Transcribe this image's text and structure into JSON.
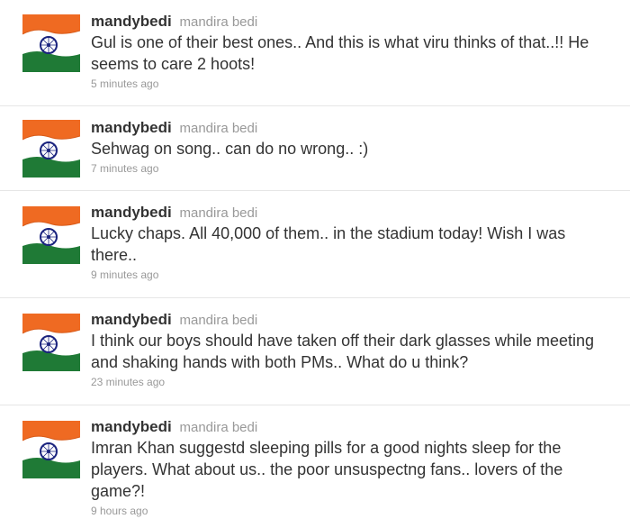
{
  "tweets": [
    {
      "screen_name": "mandybedi",
      "full_name": "mandira bedi",
      "text": "Gul is one of their best ones.. And this is what viru thinks of that..!! He seems to care 2 hoots!",
      "time": "5 minutes ago",
      "avatar_icon": "india-flag-icon"
    },
    {
      "screen_name": "mandybedi",
      "full_name": "mandira bedi",
      "text": "Sehwag on song.. can do no wrong.. :)",
      "time": "7 minutes ago",
      "avatar_icon": "india-flag-icon"
    },
    {
      "screen_name": "mandybedi",
      "full_name": "mandira bedi",
      "text": "Lucky chaps. All 40,000 of them.. in the stadium today! Wish I was there..",
      "time": "9 minutes ago",
      "avatar_icon": "india-flag-icon"
    },
    {
      "screen_name": "mandybedi",
      "full_name": "mandira bedi",
      "text": "I think our boys should have taken off their dark glasses while meeting and shaking hands with both PMs.. What do u think?",
      "time": "23 minutes ago",
      "avatar_icon": "india-flag-icon"
    },
    {
      "screen_name": "mandybedi",
      "full_name": "mandira bedi",
      "text": "Imran Khan suggestd sleeping pills for a good nights sleep for the players. What about us.. the poor unsuspectng fans.. lovers of the game?!",
      "time": "9 hours ago",
      "avatar_icon": "india-flag-icon"
    }
  ],
  "colors": {
    "saffron": "#f26b21",
    "white": "#ffffff",
    "green": "#1e7a35",
    "chakra": "#1a237e",
    "muted_text": "#999999",
    "divider": "#e6e6e6"
  }
}
